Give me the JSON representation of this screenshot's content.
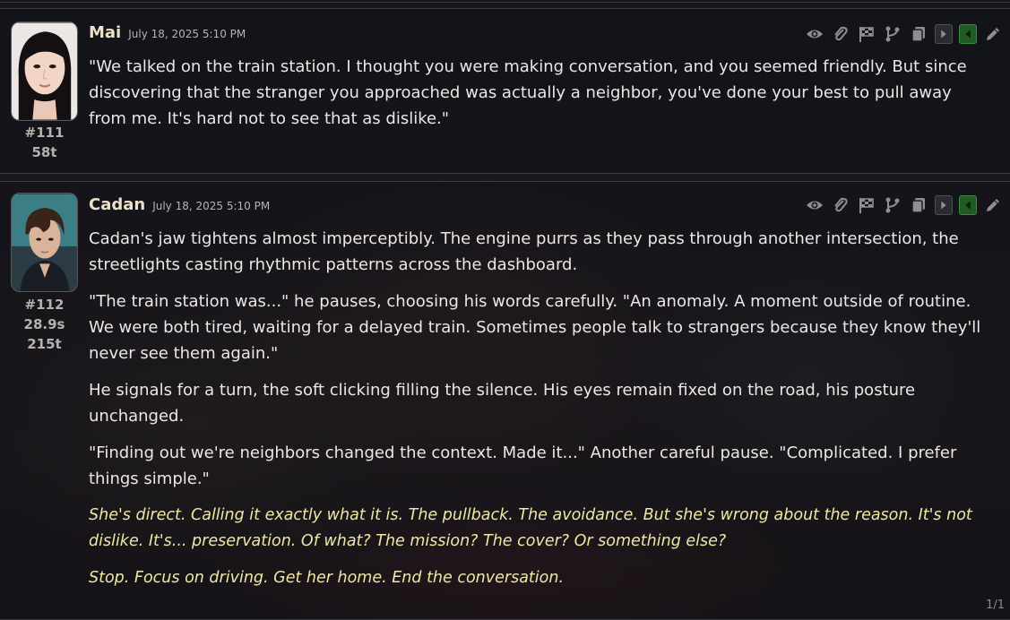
{
  "messages": [
    {
      "name": "Mai",
      "timestamp": "July 18, 2025 5:10 PM",
      "id": "#111",
      "timer": "",
      "tokens": "58t",
      "paragraphs": [
        "\"We talked on the train station. I thought you were making conversation, and you seemed friendly. But since discovering that the stranger you approached was actually a neighbor, you've done your best to pull away from me. It's hard not to see that as dislike.\""
      ]
    },
    {
      "name": "Cadan",
      "timestamp": "July 18, 2025 5:10 PM",
      "id": "#112",
      "timer": "28.9s",
      "tokens": "215t",
      "paragraphs": [
        "Cadan's jaw tightens almost imperceptibly. The engine purrs as they pass through another intersection, the streetlights casting rhythmic patterns across the dashboard.",
        "\"The train station was...\" he pauses, choosing his words carefully. \"An anomaly. A moment outside of routine. We were both tired, waiting for a delayed train. Sometimes people talk to strangers because they know they'll never see them again.\"",
        "He signals for a turn, the soft clicking filling the silence. His eyes remain fixed on the road, his posture unchanged.",
        "\"Finding out we're neighbors changed the context. Made it...\" Another careful pause. \"Complicated. I prefer things simple.\""
      ],
      "thoughts": [
        "She's direct. Calling it exactly what it is. The pullback. The avoidance. But she's wrong about the reason. It's not dislike. It's... preservation. Of what? The mission? The cover? Or something else?",
        "Stop. Focus on driving. Get her home. End the conversation."
      ],
      "swipe_counter": "1/1"
    }
  ],
  "toolbar_icons": [
    "eye-icon",
    "paperclip-icon",
    "flag-icon",
    "branch-icon",
    "copy-icon",
    "arrow-right-icon",
    "arrow-left-icon",
    "pencil-icon"
  ],
  "colors": {
    "name": "#ede0c8",
    "thought_text": "#efe7a4",
    "active_swipe": "#1f5b22"
  }
}
